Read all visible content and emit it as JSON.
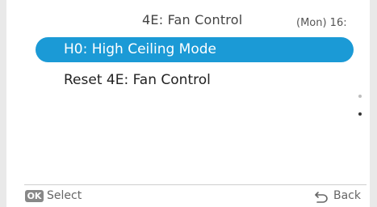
{
  "header": {
    "title": "4E: Fan Control",
    "clock": "(Mon) 16:"
  },
  "menu": {
    "items": [
      {
        "label": "H0: High Ceiling Mode",
        "selected": true
      },
      {
        "label": "Reset 4E: Fan Control",
        "selected": false
      }
    ]
  },
  "footer": {
    "ok_badge": "OK",
    "select_label": "Select",
    "back_label": "Back"
  },
  "colors": {
    "accent": "#1b9ad6"
  },
  "icons": {
    "back": "back-arrow-icon"
  }
}
